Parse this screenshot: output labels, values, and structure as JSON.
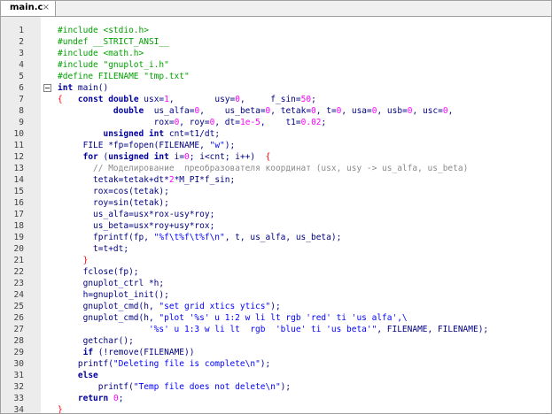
{
  "tab": {
    "title": "main.c",
    "close": "×"
  },
  "editor": {
    "lines": [
      {
        "n": "1",
        "tokens": [
          [
            "pp",
            "#include <stdio.h>"
          ]
        ]
      },
      {
        "n": "2",
        "tokens": [
          [
            "pp",
            "#undef __STRICT_ANSI__"
          ]
        ]
      },
      {
        "n": "3",
        "tokens": [
          [
            "pp",
            "#include <math.h>"
          ]
        ]
      },
      {
        "n": "4",
        "tokens": [
          [
            "pp",
            "#include \"gnuplot_i.h\""
          ]
        ]
      },
      {
        "n": "5",
        "tokens": [
          [
            "pp",
            "#define FILENAME \"tmp.txt\""
          ]
        ]
      },
      {
        "n": "6",
        "tokens": [
          [
            "kw",
            "int"
          ],
          [
            "pl",
            " main()"
          ]
        ],
        "fold": true
      },
      {
        "n": "7",
        "tokens": [
          [
            "br",
            "{"
          ],
          [
            "pl",
            "   "
          ],
          [
            "kw",
            "const double"
          ],
          [
            "pl",
            " usx="
          ],
          [
            "num",
            "1"
          ],
          [
            "pl",
            ",        usy="
          ],
          [
            "num",
            "0"
          ],
          [
            "pl",
            ",     f_sin="
          ],
          [
            "num",
            "50"
          ],
          [
            "pl",
            ";"
          ]
        ]
      },
      {
        "n": "8",
        "tokens": [
          [
            "pl",
            "           "
          ],
          [
            "kw",
            "double"
          ],
          [
            "pl",
            "  us_alfa="
          ],
          [
            "num",
            "0"
          ],
          [
            "pl",
            ",    us_beta="
          ],
          [
            "num",
            "0"
          ],
          [
            "pl",
            ", tetak="
          ],
          [
            "num",
            "0"
          ],
          [
            "pl",
            ", t="
          ],
          [
            "num",
            "0"
          ],
          [
            "pl",
            ", usa="
          ],
          [
            "num",
            "0"
          ],
          [
            "pl",
            ", usb="
          ],
          [
            "num",
            "0"
          ],
          [
            "pl",
            ", usc="
          ],
          [
            "num",
            "0"
          ],
          [
            "pl",
            ","
          ]
        ]
      },
      {
        "n": "9",
        "tokens": [
          [
            "pl",
            "                   rox="
          ],
          [
            "num",
            "0"
          ],
          [
            "pl",
            ", roy="
          ],
          [
            "num",
            "0"
          ],
          [
            "pl",
            ", dt="
          ],
          [
            "num",
            "1e-5"
          ],
          [
            "pl",
            ",    t1="
          ],
          [
            "num",
            "0.02"
          ],
          [
            "pl",
            ";"
          ]
        ]
      },
      {
        "n": "10",
        "tokens": [
          [
            "pl",
            "         "
          ],
          [
            "kw",
            "unsigned int"
          ],
          [
            "pl",
            " cnt=t1/dt;"
          ]
        ]
      },
      {
        "n": "11",
        "tokens": [
          [
            "pl",
            "     FILE *fp=fopen(FILENAME, "
          ],
          [
            "str",
            "\"w\""
          ],
          [
            "pl",
            ");"
          ]
        ]
      },
      {
        "n": "12",
        "tokens": [
          [
            "pl",
            "     "
          ],
          [
            "kw",
            "for"
          ],
          [
            "pl",
            " ("
          ],
          [
            "kw",
            "unsigned int"
          ],
          [
            "pl",
            " i="
          ],
          [
            "num",
            "0"
          ],
          [
            "pl",
            "; i<cnt; i++)  "
          ],
          [
            "br",
            "{"
          ]
        ]
      },
      {
        "n": "13",
        "tokens": [
          [
            "pl",
            "       "
          ],
          [
            "cm",
            "// Моделирование  преобразователя координат (usx, usy -> us_alfa, us_beta)"
          ]
        ]
      },
      {
        "n": "14",
        "tokens": [
          [
            "pl",
            "       tetak=tetak+dt*"
          ],
          [
            "num",
            "2"
          ],
          [
            "pl",
            "*M_PI*f_sin;"
          ]
        ]
      },
      {
        "n": "15",
        "tokens": [
          [
            "pl",
            "       rox=cos(tetak);"
          ]
        ]
      },
      {
        "n": "16",
        "tokens": [
          [
            "pl",
            "       roy=sin(tetak);"
          ]
        ]
      },
      {
        "n": "17",
        "tokens": [
          [
            "pl",
            "       us_alfa=usx*rox-usy*roy;"
          ]
        ]
      },
      {
        "n": "18",
        "tokens": [
          [
            "pl",
            "       us_beta=usx*roy+usy*rox;"
          ]
        ]
      },
      {
        "n": "19",
        "tokens": [
          [
            "pl",
            "       fprintf(fp, "
          ],
          [
            "str",
            "\"%f\\t%f\\t%f\\n\""
          ],
          [
            "pl",
            ", t, us_alfa, us_beta);"
          ]
        ]
      },
      {
        "n": "20",
        "tokens": [
          [
            "pl",
            "       t=t+dt;"
          ]
        ]
      },
      {
        "n": "21",
        "tokens": [
          [
            "pl",
            "     "
          ],
          [
            "br",
            "}"
          ]
        ]
      },
      {
        "n": "22",
        "tokens": [
          [
            "pl",
            "     fclose(fp);"
          ]
        ]
      },
      {
        "n": "23",
        "tokens": [
          [
            "pl",
            "     gnuplot_ctrl *h;"
          ]
        ]
      },
      {
        "n": "24",
        "tokens": [
          [
            "pl",
            "     h=gnuplot_init();"
          ]
        ]
      },
      {
        "n": "25",
        "tokens": [
          [
            "pl",
            "     gnuplot_cmd(h, "
          ],
          [
            "str",
            "\"set grid xtics ytics\""
          ],
          [
            "pl",
            ");"
          ]
        ]
      },
      {
        "n": "26",
        "tokens": [
          [
            "pl",
            "     gnuplot_cmd(h, "
          ],
          [
            "str",
            "\"plot '%s' u 1:2 w li lt rgb 'red' ti 'us alfa',\\"
          ]
        ]
      },
      {
        "n": "27",
        "tokens": [
          [
            "str",
            "                  '%s' u 1:3 w li lt  rgb  'blue' ti 'us beta'\""
          ],
          [
            "pl",
            ", FILENAME, FILENAME);"
          ]
        ]
      },
      {
        "n": "28",
        "tokens": [
          [
            "pl",
            "     getchar();"
          ]
        ]
      },
      {
        "n": "29",
        "tokens": [
          [
            "pl",
            "     "
          ],
          [
            "kw",
            "if"
          ],
          [
            "pl",
            " (!remove(FILENAME))"
          ]
        ]
      },
      {
        "n": "30",
        "tokens": [
          [
            "pl",
            "    printf("
          ],
          [
            "str",
            "\"Deleting file is complete\\n\""
          ],
          [
            "pl",
            ");"
          ]
        ]
      },
      {
        "n": "31",
        "tokens": [
          [
            "pl",
            "    "
          ],
          [
            "kw",
            "else"
          ]
        ]
      },
      {
        "n": "32",
        "tokens": [
          [
            "pl",
            "        printf("
          ],
          [
            "str",
            "\"Temp file does not delete\\n\""
          ],
          [
            "pl",
            ");"
          ]
        ]
      },
      {
        "n": "33",
        "tokens": [
          [
            "pl",
            "    "
          ],
          [
            "kw",
            "return"
          ],
          [
            "pl",
            " "
          ],
          [
            "num",
            "0"
          ],
          [
            "pl",
            ";"
          ]
        ]
      },
      {
        "n": "34",
        "tokens": [
          [
            "br",
            "}"
          ]
        ]
      }
    ]
  }
}
